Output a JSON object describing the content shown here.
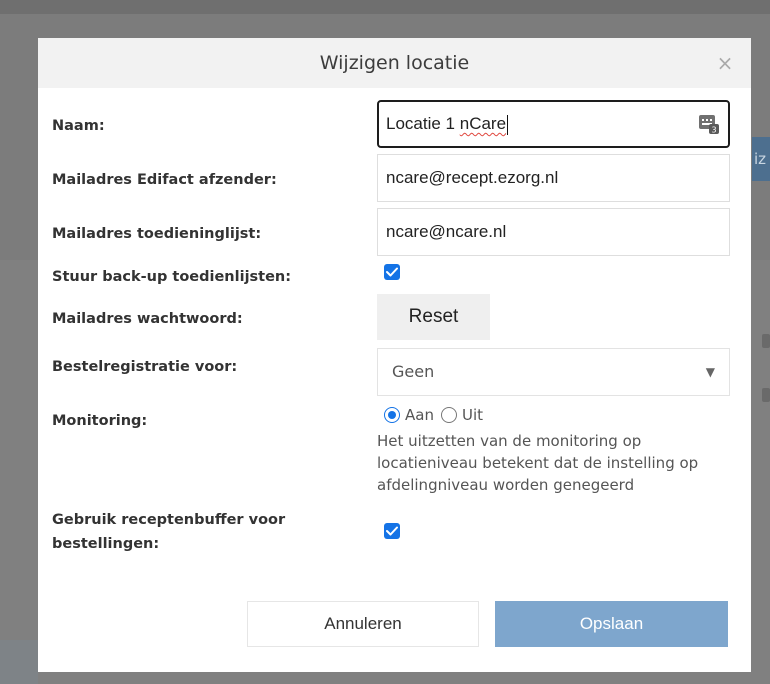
{
  "background": {
    "edge_button_text": "iz"
  },
  "modal": {
    "title": "Wijzigen locatie",
    "close_glyph": "×",
    "fields": {
      "naam": {
        "label": "Naam:",
        "value_plain": "Locatie 1 ",
        "value_flagged": "nCare"
      },
      "edifact": {
        "label": "Mailadres Edifact afzender:",
        "value": "ncare@recept.ezorg.nl"
      },
      "toedieninglijst": {
        "label": "Mailadres toedieninglijst:",
        "value": "ncare@ncare.nl"
      },
      "backup": {
        "label": "Stuur back-up toedienlijsten:",
        "checked": true
      },
      "wachtwoord": {
        "label": "Mailadres wachtwoord:",
        "button": "Reset"
      },
      "bestelregistratie": {
        "label": "Bestelregistratie voor:",
        "selected": "Geen"
      },
      "monitoring": {
        "label": "Monitoring:",
        "options": [
          {
            "label": "Aan",
            "selected": true
          },
          {
            "label": "Uit",
            "selected": false
          }
        ],
        "help": "Het uitzetten van de monitoring op locatieniveau betekent dat de instelling op afdelingniveau worden genegeerd"
      },
      "receptenbuffer": {
        "label_line1": "Gebruik receptenbuffer voor",
        "label_line2": "bestellingen:",
        "checked": true
      }
    },
    "buttons": {
      "cancel": "Annuleren",
      "save": "Opslaan"
    }
  },
  "colors": {
    "accent": "#1473e6",
    "save_button": "#7ea6cd",
    "overlay": "#7c7c7c"
  },
  "icons": {
    "keyboard": "keyboard-badge-icon",
    "dropdown": "caret-down-icon",
    "close": "close-icon"
  }
}
